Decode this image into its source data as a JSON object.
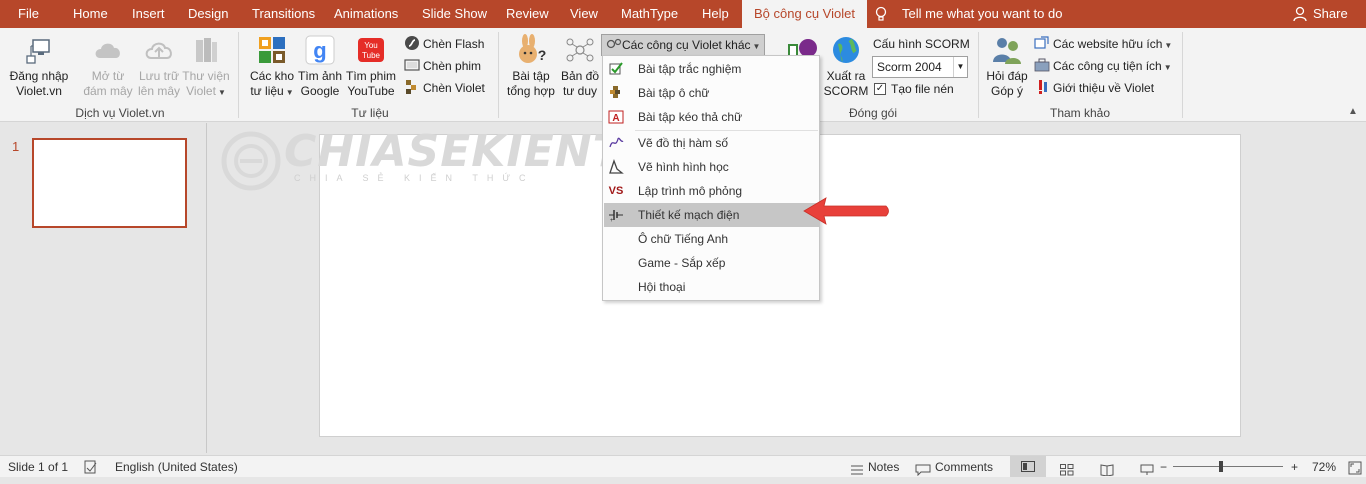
{
  "tabs": [
    "File",
    "Home",
    "Insert",
    "Design",
    "Transitions",
    "Animations",
    "Slide Show",
    "Review",
    "View",
    "MathType",
    "Help",
    "Bộ công cụ Violet"
  ],
  "tell_me": "Tell me what you want to do",
  "share": "Share",
  "ribbon": {
    "violet_service": {
      "label": "Dịch vụ Violet.vn",
      "login": [
        "Đăng nhập",
        "Violet.vn"
      ],
      "open_cloud": [
        "Mở từ",
        "đám mây"
      ],
      "save_cloud": [
        "Lưu trữ",
        "lên mây"
      ],
      "library": [
        "Thư viện",
        "Violet"
      ]
    },
    "resources": {
      "label": "Tư liệu",
      "warehouse": [
        "Các kho",
        "tư liệu"
      ],
      "google": [
        "Tìm ảnh",
        "Google"
      ],
      "youtube": [
        "Tìm phim",
        "YouTube"
      ],
      "insert_flash": "Chèn Flash",
      "insert_film": "Chèn phim",
      "insert_violet": "Chèn Violet"
    },
    "tools": {
      "summary": [
        "Bài tập",
        "tổng hợp"
      ],
      "mindmap": [
        "Bản đồ",
        "tư duy"
      ],
      "other_tools": "Các công cụ Violet khác"
    },
    "packaging": {
      "label": "Đóng gói",
      "export_scorm": [
        "Xuất ra",
        "SCORM"
      ],
      "scorm_config": "Cấu hình SCORM",
      "scorm_version": "Scorm 2004",
      "zip_file": "Tạo file nén"
    },
    "reference": {
      "label": "Tham khảo",
      "feedback": [
        "Hỏi đáp",
        "Góp ý"
      ],
      "websites": "Các website hữu ích",
      "utilities": "Các công cụ tiện ích",
      "about": "Giới thiệu về Violet"
    }
  },
  "dropdown": {
    "items": [
      "Bài tập trắc nghiệm",
      "Bài tập ô chữ",
      "Bài tập kéo thả chữ",
      "Vẽ đồ thị hàm số",
      "Vẽ hình hình học",
      "Lập trình mô phỏng",
      "Thiết kế mạch điện",
      "Ô chữ Tiếng Anh",
      "Game - Sắp xếp",
      "Hội thoại"
    ],
    "highlighted": "Thiết kế mạch điện"
  },
  "slides": {
    "number": "1"
  },
  "watermark": {
    "title": "CHIASEKIENTHUC",
    "subtitle": "CHIA SẺ KIẾN THỨC"
  },
  "status": {
    "slide": "Slide 1 of 1",
    "language": "English (United States)",
    "notes": "Notes",
    "comments": "Comments",
    "zoom": "72%"
  },
  "colors": {
    "accent": "#b7472a",
    "arrow": "#e8403a"
  }
}
